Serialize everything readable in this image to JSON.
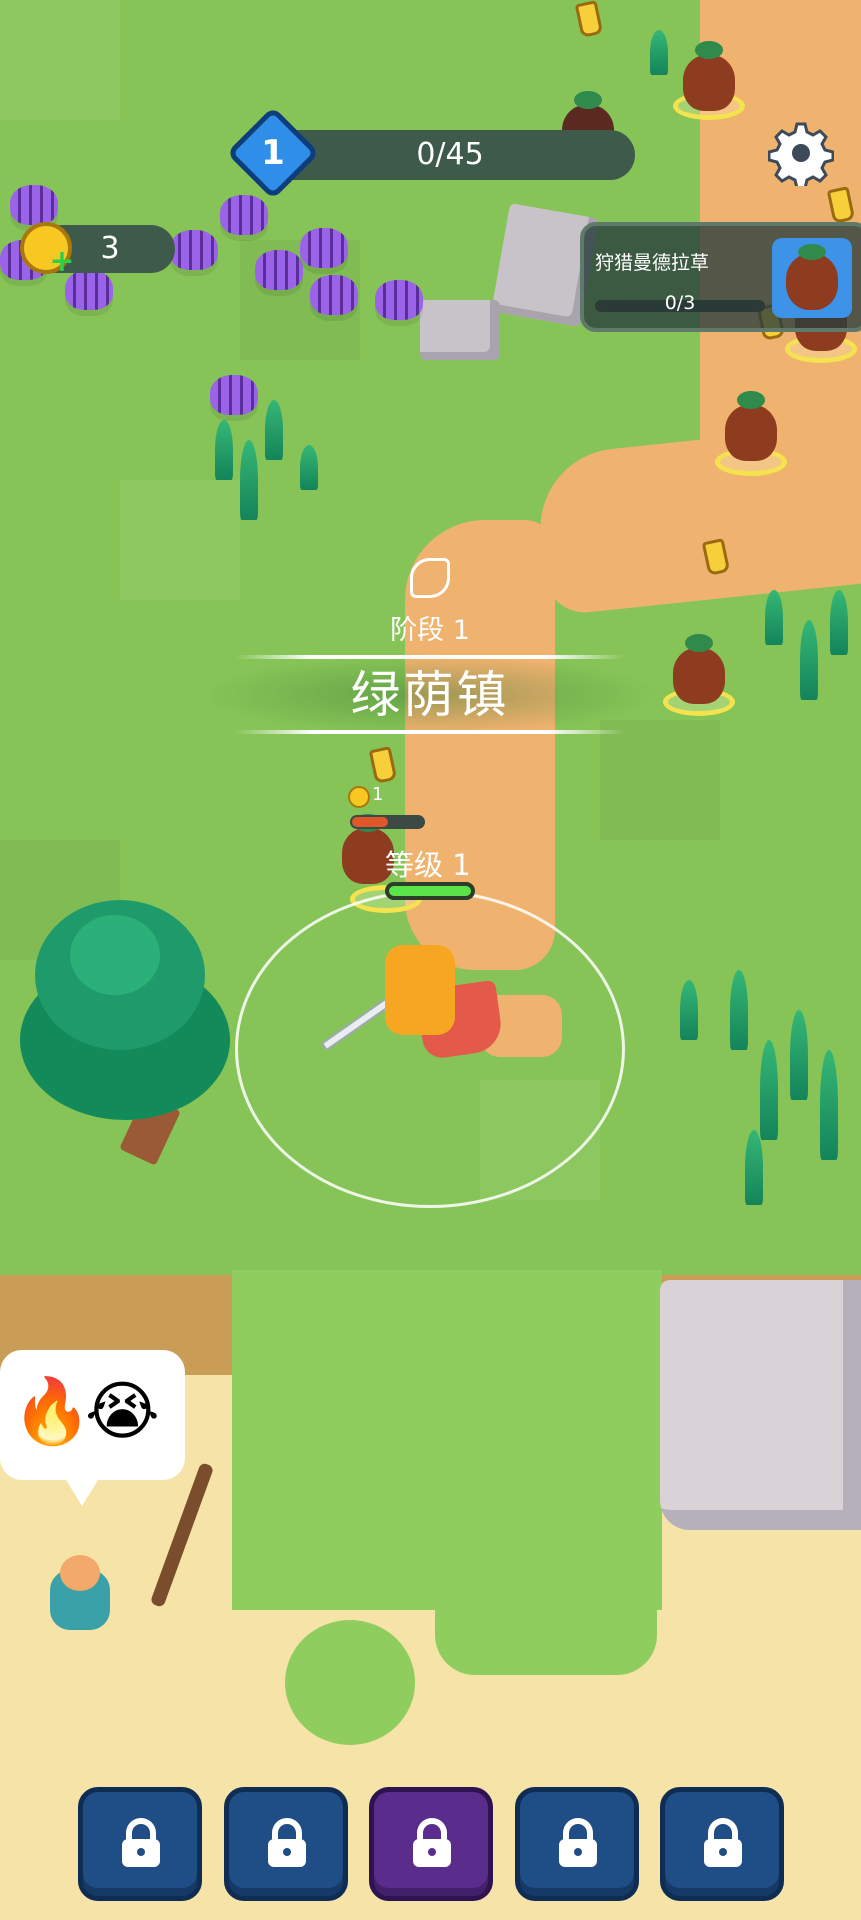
{
  "hud": {
    "player_level": "1",
    "xp_progress": "0/45",
    "coins": "3",
    "settings_icon": "gear-icon"
  },
  "quest": {
    "title": "狩猎曼德拉草",
    "progress": "0/3",
    "portrait_icon": "mandrake-icon"
  },
  "stage": {
    "label": "阶段 1",
    "name": "绿荫镇",
    "icon": "leaf-icon"
  },
  "combat": {
    "enemy_coin_reward": "1",
    "enemy_hp_fraction": 0.5,
    "player_level_label": "等级 1",
    "player_hp_fraction": 1.0
  },
  "npc_bubble": {
    "emojis": [
      "🔥",
      "😭"
    ]
  },
  "skill_slots": [
    {
      "locked": true,
      "color": "#1f4d86"
    },
    {
      "locked": true,
      "color": "#1f4d86"
    },
    {
      "locked": true,
      "color": "#5a2c8c"
    },
    {
      "locked": true,
      "color": "#1f4d86"
    },
    {
      "locked": true,
      "color": "#1f4d86"
    }
  ],
  "colors": {
    "grass": "#86c457",
    "path": "#f0b36f",
    "sand": "#f6e3a7",
    "hud_dark": "#3d5a4a",
    "level_blue": "#2f8fe8"
  }
}
